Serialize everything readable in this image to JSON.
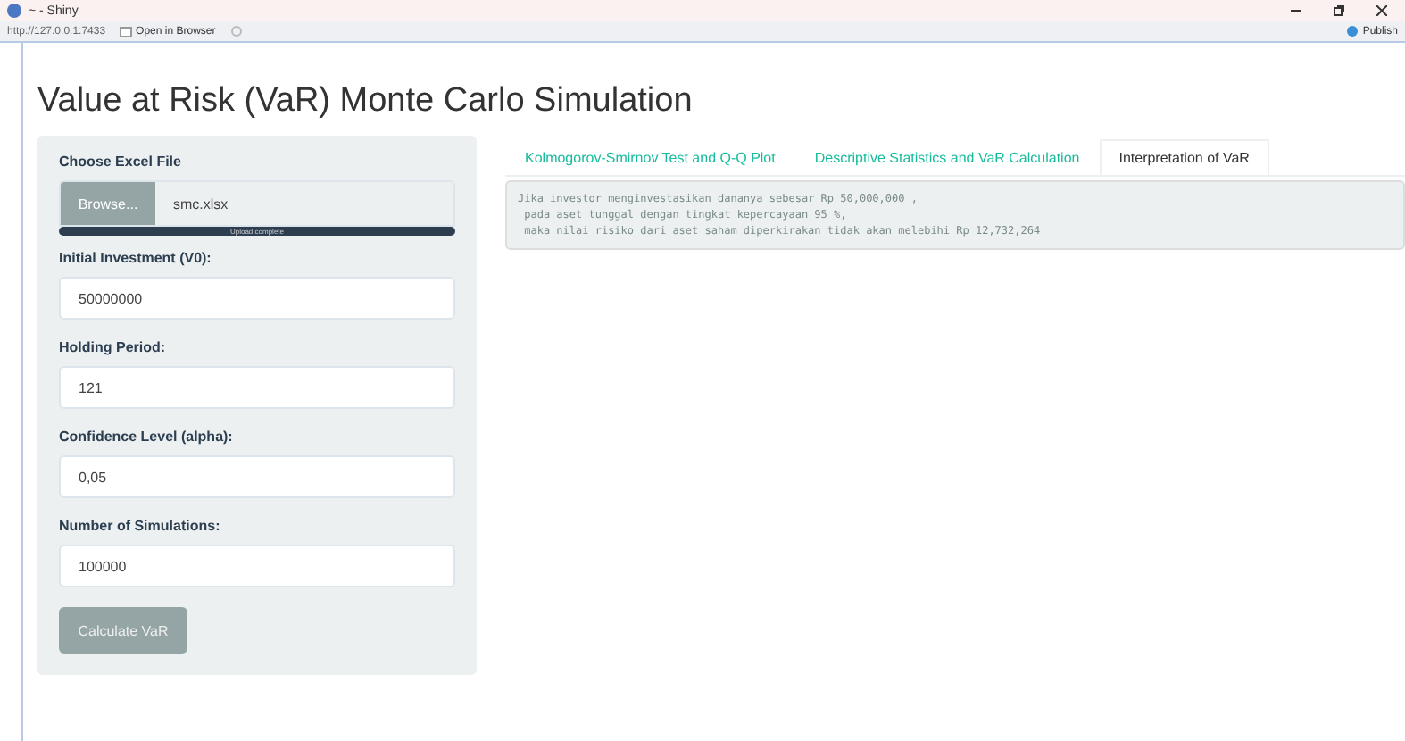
{
  "window": {
    "title": "~ - Shiny"
  },
  "toolbar": {
    "address": "http://127.0.0.1:7433",
    "open_in_browser": "Open in Browser",
    "publish": "Publish"
  },
  "page_title": "Value at Risk (VaR) Monte Carlo Simulation",
  "file_input": {
    "label": "Choose Excel File",
    "button": "Browse...",
    "filename": "smc.xlsx",
    "progress": {
      "level": 1,
      "text": "Upload complete"
    }
  },
  "inputs": [
    {
      "label": "Initial Investment (V0):",
      "value": "50000000"
    },
    {
      "label": "Holding Period:",
      "value": "121"
    },
    {
      "label": "Confidence Level (alpha):",
      "value": "0,05"
    },
    {
      "label": "Number of Simulations:",
      "value": "100000"
    }
  ],
  "calculate_button": "Calculate VaR",
  "tabs": [
    {
      "label": "Kolmogorov-Smirnov Test and Q-Q Plot",
      "selected": false
    },
    {
      "label": "Descriptive Statistics and VaR Calculation",
      "selected": false
    },
    {
      "label": "Interpretation of VaR",
      "selected": true
    }
  ],
  "output": [
    "Jika investor menginvestasikan dananya sebesar Rp 50,000,000 ,",
    " pada aset tunggal dengan tingkat kepercayaan 95 %,",
    " maka nilai risiko dari aset saham diperkirakan tidak akan melebihi Rp 12,732,264"
  ]
}
